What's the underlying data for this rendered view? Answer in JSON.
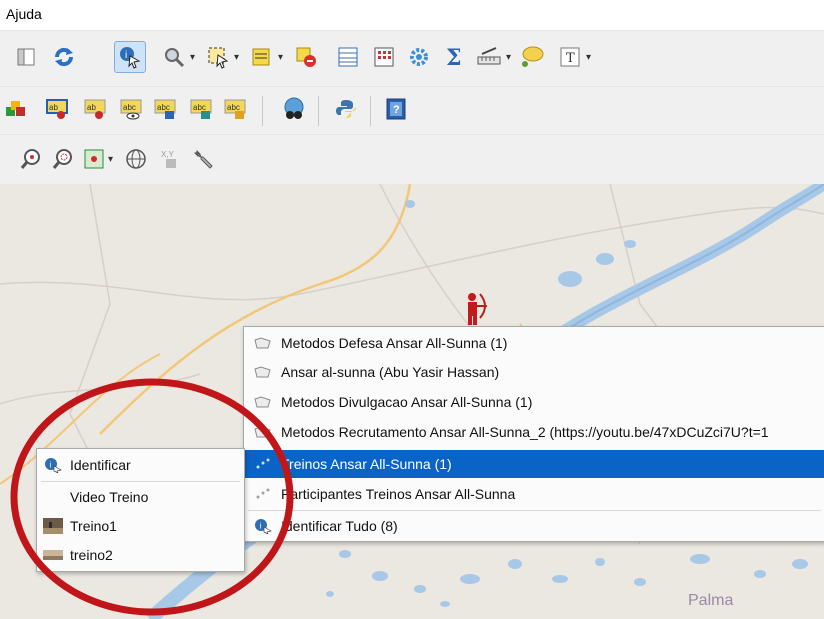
{
  "menubar": {
    "help_menu": "Ajuda"
  },
  "toolbars": {
    "row1": [
      "panel-icon",
      "refresh-icon",
      "identify-features-icon",
      "zoom-identify-icon",
      "select-features-icon",
      "open-table-icon",
      "deselect-icon",
      "attribute-table-icon",
      "field-calculator-icon",
      "settings-gear-icon",
      "statistics-sum-icon",
      "measure-line-icon",
      "map-tips-icon",
      "text-annotation-icon"
    ],
    "row2": [
      "layer-styling-icon",
      "label-pin-icon",
      "label-pin-red-icon",
      "label-view-icon",
      "label-move-icon",
      "label-rotate-icon",
      "label-edit-icon",
      "globe-binoculars-icon",
      "python-icon",
      "help-icon"
    ],
    "row3": [
      "zoom-in-icon",
      "zoom-out-icon",
      "zoom-full-icon",
      "globe-icon",
      "xy-coordinates-icon",
      "wrench-icon"
    ]
  },
  "context_menu": {
    "items": [
      {
        "label": "Metodos Defesa Ansar All-Sunna (1)",
        "icon": "polygon-layer-icon",
        "selected": false
      },
      {
        "label": "Ansar al-sunna (Abu Yasir Hassan)",
        "icon": "polygon-layer-icon",
        "selected": false
      },
      {
        "label": "Metodos Divulgacao Ansar All-Sunna (1)",
        "icon": "polygon-layer-icon",
        "selected": false
      },
      {
        "label": "Metodos Recrutamento Ansar All-Sunna_2 (https://youtu.be/47xDCuZci7U?t=1",
        "icon": "polygon-layer-icon",
        "selected": false
      },
      {
        "label": "Treinos Ansar All-Sunna (1)",
        "icon": "point-layer-icon",
        "selected": true
      },
      {
        "label": "Participantes Treinos Ansar All-Sunna",
        "icon": "point-layer-icon",
        "selected": false
      }
    ],
    "identify_all": {
      "label": "Identificar Tudo (8)",
      "icon": "identify-icon"
    }
  },
  "submenu": {
    "identify": {
      "label": "Identificar",
      "icon": "identify-icon"
    },
    "items": [
      {
        "label": "Video Treino",
        "icon": ""
      },
      {
        "label": "Treino1",
        "icon": "photo-thumbnail-icon"
      },
      {
        "label": "treino2",
        "icon": "photo-thumbnail-icon"
      }
    ]
  },
  "map": {
    "place_label": "Palma"
  },
  "colors": {
    "selection": "#0a64c8",
    "water": "#a8c8e8",
    "highlight_circle": "#c0161a",
    "road": "#f2c878"
  }
}
